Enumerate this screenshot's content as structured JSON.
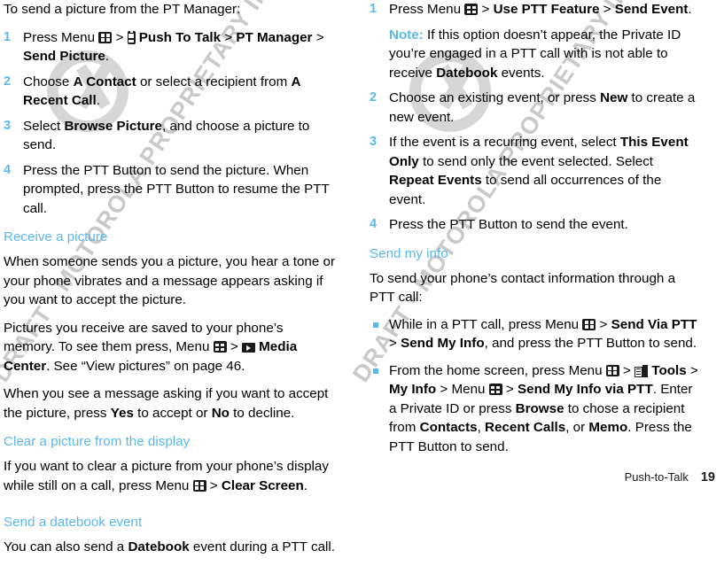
{
  "footer": {
    "chapter": "Push-to-Talk",
    "page_number": "19"
  },
  "watermark": {
    "text": "DRAFT - MOTOROLA PROPRIETARY INFORMATION CONFIDENTIAL",
    "logo": "motorola-m-logo"
  },
  "icons": {
    "menu": "menu-icon",
    "push_to_talk": "push-to-talk-phone-icon",
    "media_center": "media-center-icon",
    "tools": "tools-icon"
  },
  "colors": {
    "heading_blue": "#5bb8ea",
    "body_black": "#000000",
    "watermark_gray": "#c9c9c9"
  },
  "left_column": {
    "intro": "To send a picture from the PT Manager:",
    "steps": [
      {
        "num": "1",
        "parts": [
          {
            "t": "Press Menu ",
            "b": false
          },
          {
            "t": "icon:menu"
          },
          {
            "t": " > ",
            "b": false
          },
          {
            "t": "icon:phone"
          },
          {
            "t": "  Push To Talk",
            "b": true
          },
          {
            "t": " > ",
            "b": false
          },
          {
            "t": "PT Manager",
            "b": true
          },
          {
            "t": " > ",
            "b": false
          },
          {
            "t": "Send Picture",
            "b": true
          },
          {
            "t": ".",
            "b": false
          }
        ]
      },
      {
        "num": "2",
        "parts": [
          {
            "t": "Choose ",
            "b": false
          },
          {
            "t": "A Contact",
            "b": true
          },
          {
            "t": " or select a recipient from ",
            "b": false
          },
          {
            "t": "A Recent Call",
            "b": true
          },
          {
            "t": ".",
            "b": false
          }
        ]
      },
      {
        "num": "3",
        "parts": [
          {
            "t": "Select ",
            "b": false
          },
          {
            "t": "Browse Picture",
            "b": true
          },
          {
            "t": ", and choose a picture to send.",
            "b": false
          }
        ]
      },
      {
        "num": "4",
        "parts": [
          {
            "t": "Press the PTT Button to send the picture. When prompted, press the PTT Button to resume the PTT call.",
            "b": false
          }
        ]
      }
    ],
    "heading_receive": "Receive a picture",
    "para_receive_1": "When someone sends you a picture, you hear a tone or your phone vibrates and a message appears asking if you want to accept the picture.",
    "para_receive_2": [
      {
        "t": "Pictures you receive are saved to your phone’s memory. To see them press, Menu ",
        "b": false
      },
      {
        "t": "icon:menu"
      },
      {
        "t": " > ",
        "b": false
      },
      {
        "t": "icon:media"
      },
      {
        "t": " Media Center",
        "b": true
      },
      {
        "t": ". See “View pictures” on page 46.",
        "b": false
      }
    ],
    "para_receive_3": [
      {
        "t": "When you see a message asking if you want to accept the picture, press ",
        "b": false
      },
      {
        "t": "Yes",
        "b": true
      },
      {
        "t": " to accept or ",
        "b": false
      },
      {
        "t": "No",
        "b": true
      },
      {
        "t": " to decline.",
        "b": false
      }
    ],
    "heading_clear": "Clear a picture from the display",
    "para_clear": [
      {
        "t": "If you want to clear a picture from your phone’s display while still on a call, press Menu ",
        "b": false
      },
      {
        "t": "icon:menu"
      },
      {
        "t": " > ",
        "b": false
      },
      {
        "t": "Clear Screen",
        "b": true
      },
      {
        "t": ".",
        "b": false
      }
    ],
    "heading_datebook": "Send a datebook event",
    "para_datebook": [
      {
        "t": "You can also send a ",
        "b": false
      },
      {
        "t": "Datebook",
        "b": true
      },
      {
        "t": " event during a PTT call.",
        "b": false
      }
    ]
  },
  "right_column": {
    "steps": [
      {
        "num": "1",
        "parts": [
          {
            "t": "Press Menu ",
            "b": false
          },
          {
            "t": "icon:menu"
          },
          {
            "t": " > ",
            "b": false
          },
          {
            "t": "Use PTT Feature",
            "b": true
          },
          {
            "t": " > ",
            "b": false
          },
          {
            "t": "Send Event",
            "b": true
          },
          {
            "t": ".",
            "b": false
          }
        ],
        "note": {
          "label": "Note:",
          "parts": [
            {
              "t": " If this option doesn’t appear, the Private ID you’re engaged in a PTT call with is not able to receive ",
              "b": false
            },
            {
              "t": "Datebook",
              "b": true
            },
            {
              "t": " events.",
              "b": false
            }
          ]
        }
      },
      {
        "num": "2",
        "parts": [
          {
            "t": "Choose an existing event, or press ",
            "b": false
          },
          {
            "t": "New",
            "b": true
          },
          {
            "t": " to create a new event.",
            "b": false
          }
        ]
      },
      {
        "num": "3",
        "parts": [
          {
            "t": "If the event is a recurring event, select ",
            "b": false
          },
          {
            "t": "This Event Only",
            "b": true
          },
          {
            "t": " to send only the event selected. Select ",
            "b": false
          },
          {
            "t": "Repeat Events",
            "b": true
          },
          {
            "t": " to send all occurrences of the event.",
            "b": false
          }
        ]
      },
      {
        "num": "4",
        "parts": [
          {
            "t": "Press the PTT Button to send the event.",
            "b": false
          }
        ]
      }
    ],
    "heading_send_my_info": "Send my info",
    "para_send_my_info": "To send your phone’s contact information through a PTT call:",
    "bullets": [
      [
        {
          "t": "While in a PTT call, press Menu ",
          "b": false
        },
        {
          "t": "icon:menu"
        },
        {
          "t": " > ",
          "b": false
        },
        {
          "t": "Send Via PTT",
          "b": true
        },
        {
          "t": " > ",
          "b": false
        },
        {
          "t": "Send My Info",
          "b": true
        },
        {
          "t": ", and press the PTT Button to send.",
          "b": false
        }
      ],
      [
        {
          "t": "From the home screen, press Menu ",
          "b": false
        },
        {
          "t": "icon:menu"
        },
        {
          "t": " > ",
          "b": false
        },
        {
          "t": "icon:tools"
        },
        {
          "t": " Tools",
          "b": true
        },
        {
          "t": " > ",
          "b": false
        },
        {
          "t": "My Info",
          "b": true
        },
        {
          "t": " > Menu ",
          "b": false
        },
        {
          "t": "icon:menu"
        },
        {
          "t": " > ",
          "b": false
        },
        {
          "t": "Send My Info via PTT",
          "b": true
        },
        {
          "t": ". Enter a Private ID or press ",
          "b": false
        },
        {
          "t": "Browse",
          "b": true
        },
        {
          "t": " to chose a recipient from ",
          "b": false
        },
        {
          "t": "Contacts",
          "b": true
        },
        {
          "t": ", ",
          "b": false
        },
        {
          "t": "Recent Calls",
          "b": true
        },
        {
          "t": ", or ",
          "b": false
        },
        {
          "t": "Memo",
          "b": true
        },
        {
          "t": ".  Press the PTT Button to send.",
          "b": false
        }
      ]
    ]
  }
}
